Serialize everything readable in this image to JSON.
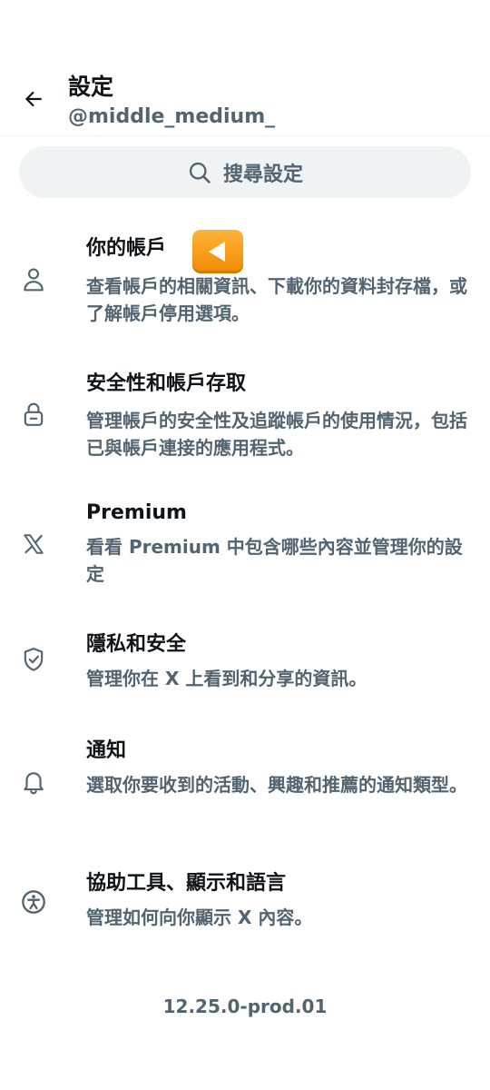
{
  "header": {
    "title": "設定",
    "handle": "@middle_medium_"
  },
  "search": {
    "placeholder": "搜尋設定"
  },
  "items": [
    {
      "title": "你的帳戶",
      "desc": "查看帳戶的相關資訊、下載你的資料封存檔，或了解帳戶停用選項。",
      "icon": "person-icon"
    },
    {
      "title": "安全性和帳戶存取",
      "desc": "管理帳戶的安全性及追蹤帳戶的使用情況，包括已與帳戶連接的應用程式。",
      "icon": "lock-icon"
    },
    {
      "title": "Premium",
      "desc": "看看 Premium 中包含哪些內容並管理你的設定",
      "icon": "x-logo-icon"
    },
    {
      "title": "隱私和安全",
      "desc": "管理你在 X 上看到和分享的資訊。",
      "icon": "shield-check-icon"
    },
    {
      "title": "通知",
      "desc": "選取你要收到的活動、興趣和推薦的通知類型。",
      "icon": "bell-icon"
    },
    {
      "title": "協助工具、顯示和語言",
      "desc": "管理如何向你顯示 X 內容。",
      "icon": "accessibility-icon"
    }
  ],
  "footer": {
    "version": "12.25.0-prod.01"
  },
  "colors": {
    "text_primary": "#0f1419",
    "text_secondary": "#536471",
    "search_bg": "#eff3f4",
    "pointer_orange": "#f59a13"
  }
}
